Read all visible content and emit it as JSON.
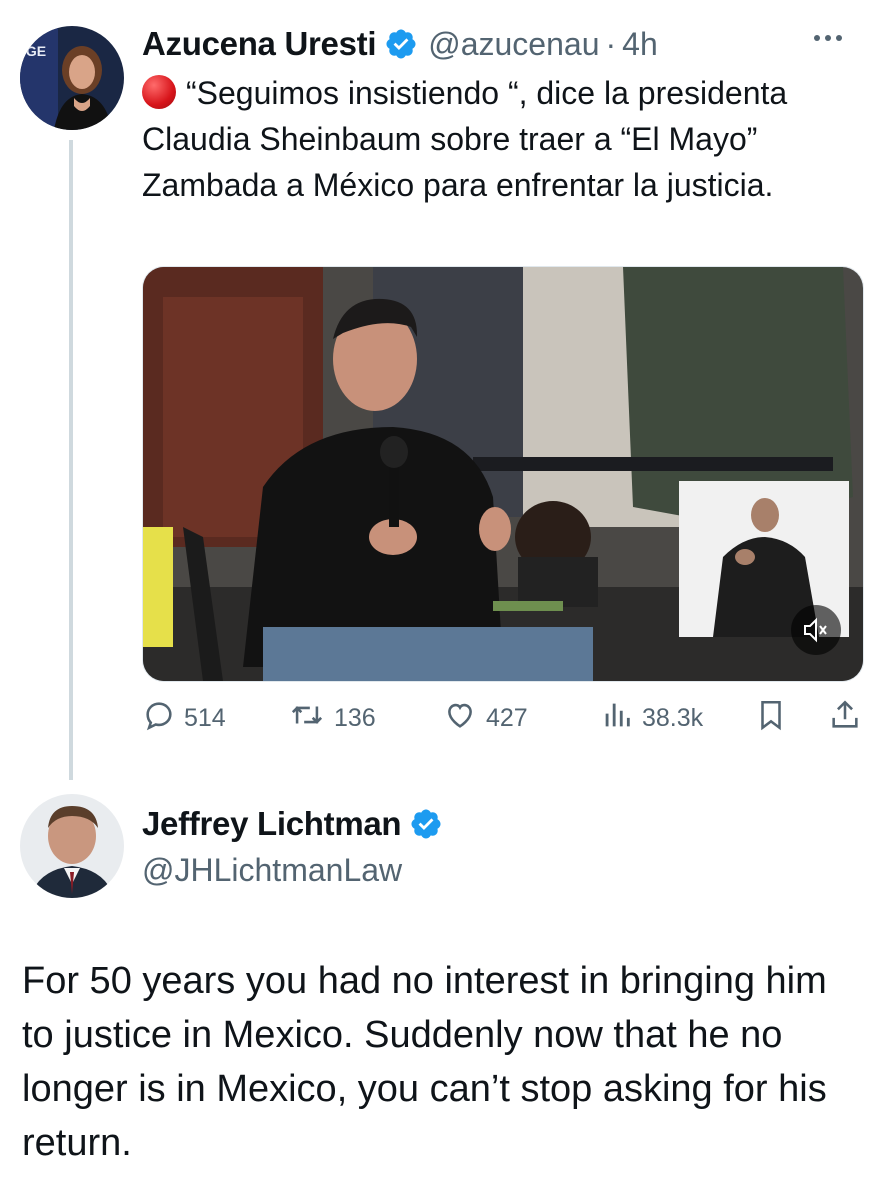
{
  "tweet1": {
    "author_name": "Azucena Uresti",
    "handle": "@azucenau",
    "separator": "·",
    "time": "4h",
    "avatar_badge_text": "IGE",
    "status_emoji": "red-circle",
    "text": "“Seguimos insistiendo “, dice la presidenta Claudia Sheinbaum sobre traer a “El Mayo” Zambada a México para enfrentar la justicia.",
    "actions": {
      "replies": "514",
      "reposts": "136",
      "likes": "427",
      "views": "38.3k"
    },
    "media": {
      "type": "video",
      "muted": true
    }
  },
  "tweet2": {
    "author_name": "Jeffrey Lichtman",
    "handle": "@JHLichtmanLaw",
    "text": "For 50 years you had no interest in bringing him to justice in Mexico. Suddenly now that he no longer is in Mexico, you can’t stop asking for his return."
  },
  "icons": {
    "verified": "verified-badge-icon",
    "more": "more-icon",
    "reply": "reply-icon",
    "repost": "repost-icon",
    "like": "like-icon",
    "views": "views-icon",
    "bookmark": "bookmark-icon",
    "share": "share-icon",
    "mute": "mute-icon"
  },
  "colors": {
    "verified_blue": "#1d9bf0",
    "secondary_text": "#536471",
    "primary_text": "#0f1419",
    "thread_line": "#cfd9de",
    "red_circle": "#d7141a"
  }
}
